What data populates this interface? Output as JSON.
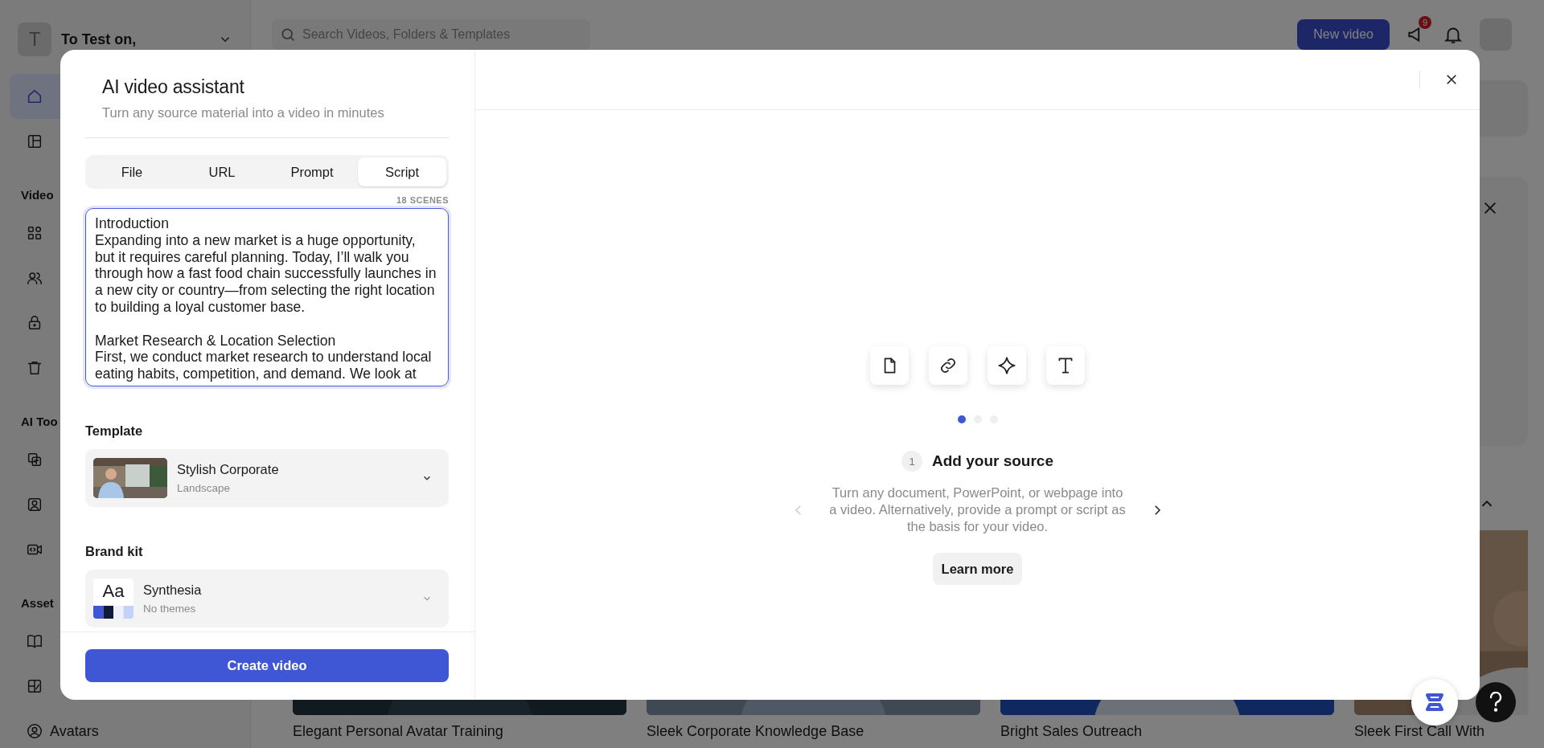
{
  "workspace": {
    "initial": "T",
    "name": "To Test on,"
  },
  "sidebar": {
    "items": [
      {
        "kind": "item",
        "selected": true
      },
      {
        "kind": "item",
        "selected": false
      },
      {
        "kind": "section",
        "label": "Video"
      },
      {
        "kind": "item",
        "selected": false
      },
      {
        "kind": "item",
        "selected": false
      },
      {
        "kind": "item",
        "selected": false
      },
      {
        "kind": "item",
        "selected": false
      },
      {
        "kind": "section",
        "label": "AI Too"
      },
      {
        "kind": "item",
        "selected": false
      },
      {
        "kind": "item",
        "selected": false
      },
      {
        "kind": "item",
        "selected": false
      },
      {
        "kind": "section",
        "label": "Asset"
      },
      {
        "kind": "item",
        "selected": false
      },
      {
        "kind": "item",
        "selected": false
      },
      {
        "kind": "item",
        "label": "Avatars",
        "selected": false
      }
    ]
  },
  "search": {
    "placeholder": "Search Videos, Folders & Templates"
  },
  "header": {
    "new_video": "New video",
    "notification_count": "9"
  },
  "video_cards": [
    {
      "title": "Elegant Personal Avatar Training"
    },
    {
      "title": "Sleek Corporate Knowledge Base"
    },
    {
      "title": "Bright Sales Outreach"
    },
    {
      "title": "Sleek First Call With"
    }
  ],
  "modal": {
    "title": "AI video assistant",
    "subtitle": "Turn any source material into a video in minutes",
    "tabs": [
      {
        "label": "File",
        "selected": false
      },
      {
        "label": "URL",
        "selected": false
      },
      {
        "label": "Prompt",
        "selected": false
      },
      {
        "label": "Script",
        "selected": true
      }
    ],
    "scene_count": "18 SCENES",
    "script": "Introduction\nExpanding into a new market is a huge opportunity, but it requires careful planning. Today, I’ll walk you through how a fast food chain successfully launches in a new city or country—from selecting the right location to building a loyal customer base.\n\nMarket Research & Location Selection\nFirst, we conduct market research to understand local eating habits, competition, and demand. We look at",
    "template": {
      "label": "Template",
      "name": "Stylish Corporate",
      "format": "Landscape"
    },
    "brand_kit": {
      "label": "Brand kit",
      "sample": "Aa",
      "name": "Synthesia",
      "themes": "No themes"
    },
    "create_button": "Create video",
    "onboarding": {
      "slides": [
        {
          "selected": true
        },
        {
          "selected": false
        },
        {
          "selected": false
        }
      ],
      "step": "1",
      "title": "Add your source",
      "description": "Turn any document, PowerPoint, or webpage into a video. Alternatively, provide a prompt or script as the basis for your video.",
      "learn_more": "Learn more"
    }
  }
}
